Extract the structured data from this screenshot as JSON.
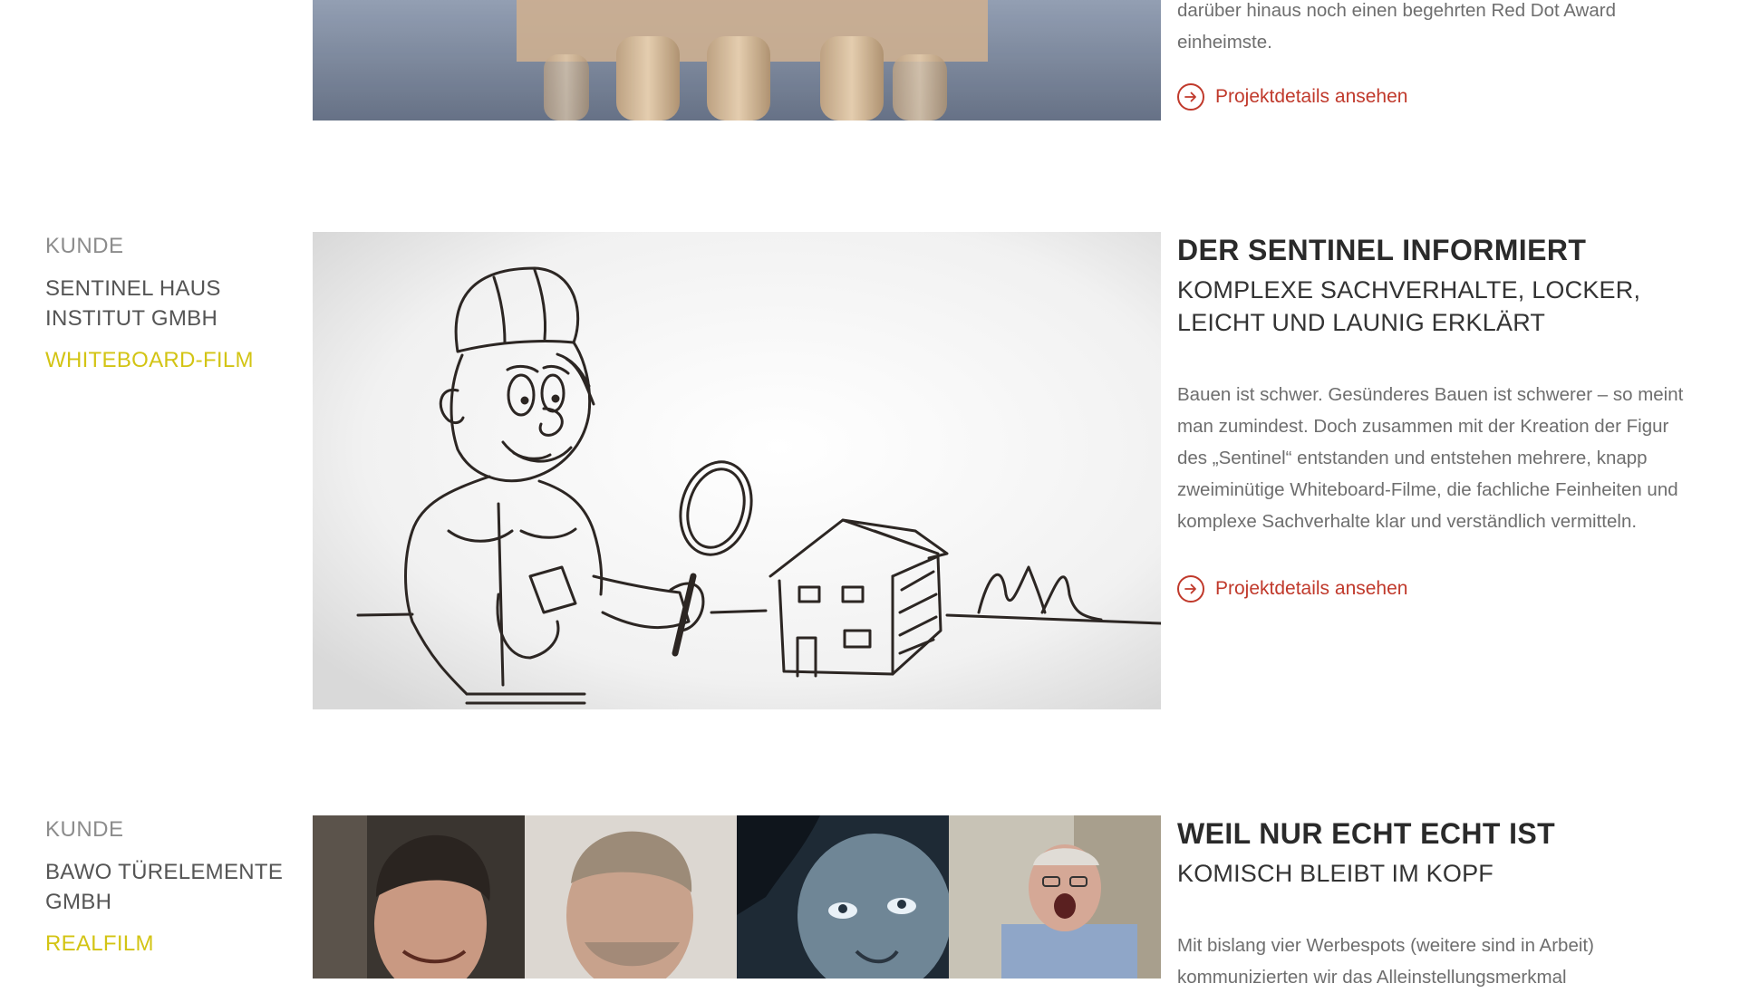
{
  "colors": {
    "accent_red": "#c0392b",
    "accent_yellow": "#d3c414",
    "muted_gray": "#8c8c8c"
  },
  "project_prev": {
    "text_tail_1": "darüber hinaus noch einen begehrten Red Dot Award",
    "text_tail_2": "einheimste.",
    "link": "Projektdetails ansehen",
    "link_icon": "arrow-right-circle-icon"
  },
  "project_sentinel": {
    "kunde_label": "KUNDE",
    "client": "SENTINEL HAUS INSTITUT GMBH",
    "kind": "WHITEBOARD-FILM",
    "title": "DER SENTINEL INFORMIERT",
    "subtitle": "KOMPLEXE SACHVERHALTE, LOCKER, LEICHT UND LAUNIG ERKLÄRT",
    "body": "Bauen ist schwer. Gesünderes Bauen ist schwerer – so meint man zumindest. Doch zusammen mit der Kreation der Figur des „Sentinel“ entstanden und entstehen mehrere, knapp zweiminütige Whiteboard-Filme, die fachliche Feinheiten und komplexe Sachverhalte klar und verständlich vermitteln.",
    "link": "Projektdetails ansehen",
    "link_icon": "arrow-right-circle-icon"
  },
  "project_bawo": {
    "kunde_label": "KUNDE",
    "client": "BAWO TÜRELEMENTE GMBH",
    "kind": "REALFILM",
    "title": "WEIL NUR ECHT ECHT IST",
    "subtitle": "KOMISCH BLEIBT IM KOPF",
    "body_line_1": "Mit bislang vier Werbespots (weitere sind in Arbeit)",
    "body_line_2": "kommunizierten wir das Alleinstellungsmerkmal"
  }
}
